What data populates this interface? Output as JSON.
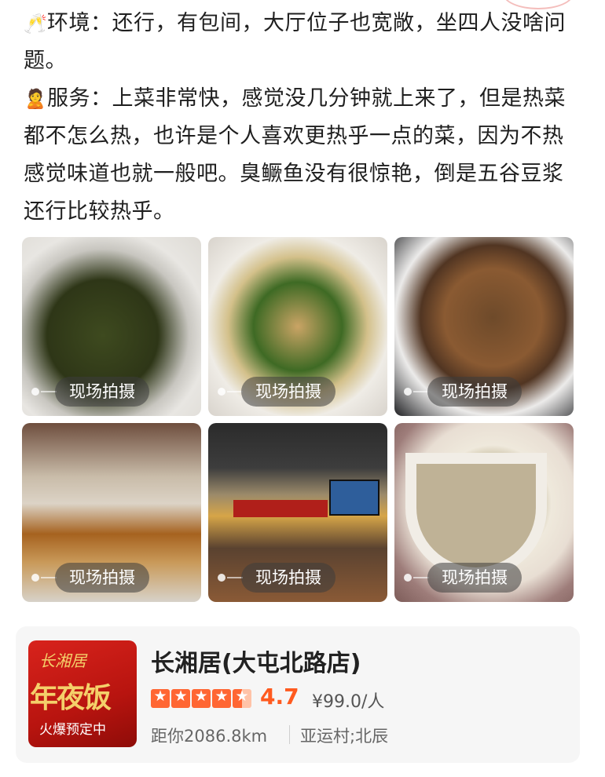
{
  "review": {
    "env_emoji": "🥂",
    "env_line": "环境：还行，有包间，大厅位子也宽敞，坐四人没啥问题。",
    "service_emoji": "🙎",
    "service_line": "服务：上菜非常快，感觉没几分钟就上来了，但是热菜都不怎么热，也许是个人喜欢更热乎一点的菜，因为不热感觉味道也就一般吧。臭鳜鱼没有很惊艳，倒是五谷豆浆还行比较热乎。"
  },
  "photos": [
    {
      "badge": "现场拍摄",
      "subject": "stir-fried greens"
    },
    {
      "badge": "现场拍摄",
      "subject": "tofu with green peppers"
    },
    {
      "badge": "现场拍摄",
      "subject": "stir-fried noodles"
    },
    {
      "badge": "现场拍摄",
      "subject": "braised fish"
    },
    {
      "badge": "现场拍摄",
      "subject": "restaurant interior"
    },
    {
      "badge": "现场拍摄",
      "subject": "cup of soy milk"
    }
  ],
  "poi": {
    "logo_top": "长湘居",
    "logo_main": "年夜饭",
    "logo_sub": "火爆预定中",
    "name": "长湘居(大屯北路店)",
    "star_rating": 4.7,
    "rating": "4.7",
    "price": "¥99.0/人",
    "distance": "距你2086.8km",
    "area": "亚运村;北辰"
  },
  "colors": {
    "accent": "#ff5a1f",
    "star": "#ff6633",
    "card_bg": "#f6f6f6",
    "logo_red": "#d8231c"
  }
}
